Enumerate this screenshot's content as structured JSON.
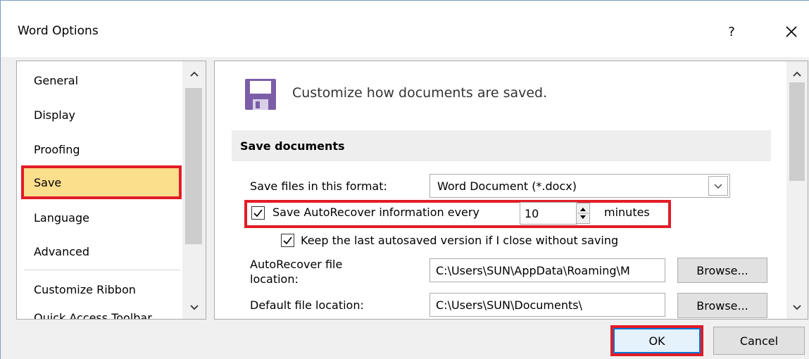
{
  "window": {
    "title": "Word Options",
    "help_label": "?"
  },
  "nav": {
    "items": [
      {
        "label": "General"
      },
      {
        "label": "Display"
      },
      {
        "label": "Proofing"
      },
      {
        "label": "Save"
      },
      {
        "label": "Language"
      },
      {
        "label": "Advanced"
      },
      {
        "label": "Customize Ribbon"
      },
      {
        "label": "Quick Access Toolbar"
      }
    ],
    "selected": "Save"
  },
  "content": {
    "heading": "Customize how documents are saved.",
    "section_title": "Save documents",
    "format": {
      "label": "Save files in this format:",
      "value": "Word Document (*.docx)"
    },
    "autorecover": {
      "checked": true,
      "label": "Save AutoRecover information every",
      "minutes_value": "10",
      "unit": "minutes"
    },
    "keep_last": {
      "checked": true,
      "label": "Keep the last autosaved version if I close without saving"
    },
    "autorecover_location": {
      "label_line1": "AutoRecover file",
      "label_line2": "location:",
      "value": "C:\\Users\\SUN\\AppData\\Roaming\\M",
      "browse": "Browse..."
    },
    "default_location": {
      "label": "Default file location:",
      "value": "C:\\Users\\SUN\\Documents\\",
      "browse": "Browse..."
    }
  },
  "footer": {
    "ok": "OK",
    "cancel": "Cancel"
  },
  "colors": {
    "highlight": "#e21c26",
    "selected_nav": "#fcdf8d",
    "floppy": "#7b5ea7"
  }
}
